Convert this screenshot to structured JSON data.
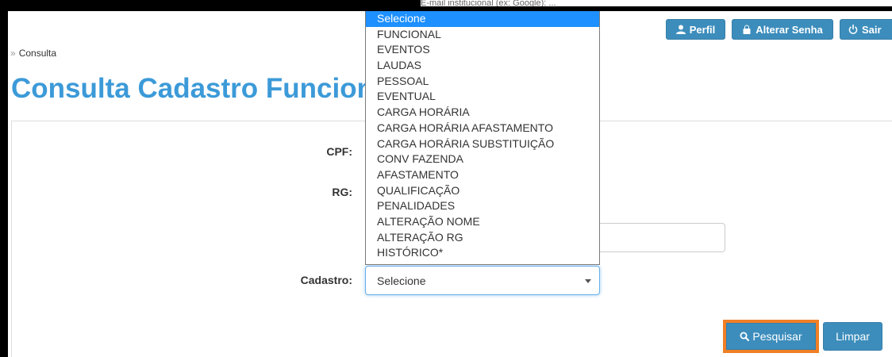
{
  "header": {
    "buttons": {
      "perfil": "Perfil",
      "alterar_senha": "Alterar Senha",
      "sair": "Sair"
    },
    "top_strip_text": "E-mail institucional (ex: Google): ..."
  },
  "breadcrumb": "Consulta",
  "page_title": "Consulta Cadastro Funcional",
  "form": {
    "cpf_label": "CPF:",
    "rg_label": "RG:",
    "cadastro_label": "Cadastro:",
    "cadastro_value": "Selecione",
    "cadastro_options": [
      "Selecione",
      "FUNCIONAL",
      "EVENTOS",
      "LAUDAS",
      "PESSOAL",
      "EVENTUAL",
      "CARGA HORÁRIA",
      "CARGA HORÁRIA AFASTAMENTO",
      "CARGA HORÁRIA SUBSTITUIÇÃO",
      "CONV FAZENDA",
      "AFASTAMENTO",
      "QUALIFICAÇÃO",
      "PENALIDADES",
      "ALTERAÇÃO NOME",
      "ALTERAÇÃO RG",
      "HISTÓRICO*"
    ],
    "selected_option": "Selecione"
  },
  "actions": {
    "pesquisar": "Pesquisar",
    "limpar": "Limpar"
  },
  "colors": {
    "primary": "#3c8dbc",
    "title": "#3c9ad8",
    "highlight_border": "#f07f26",
    "selected_option_bg": "#1e90ff"
  }
}
